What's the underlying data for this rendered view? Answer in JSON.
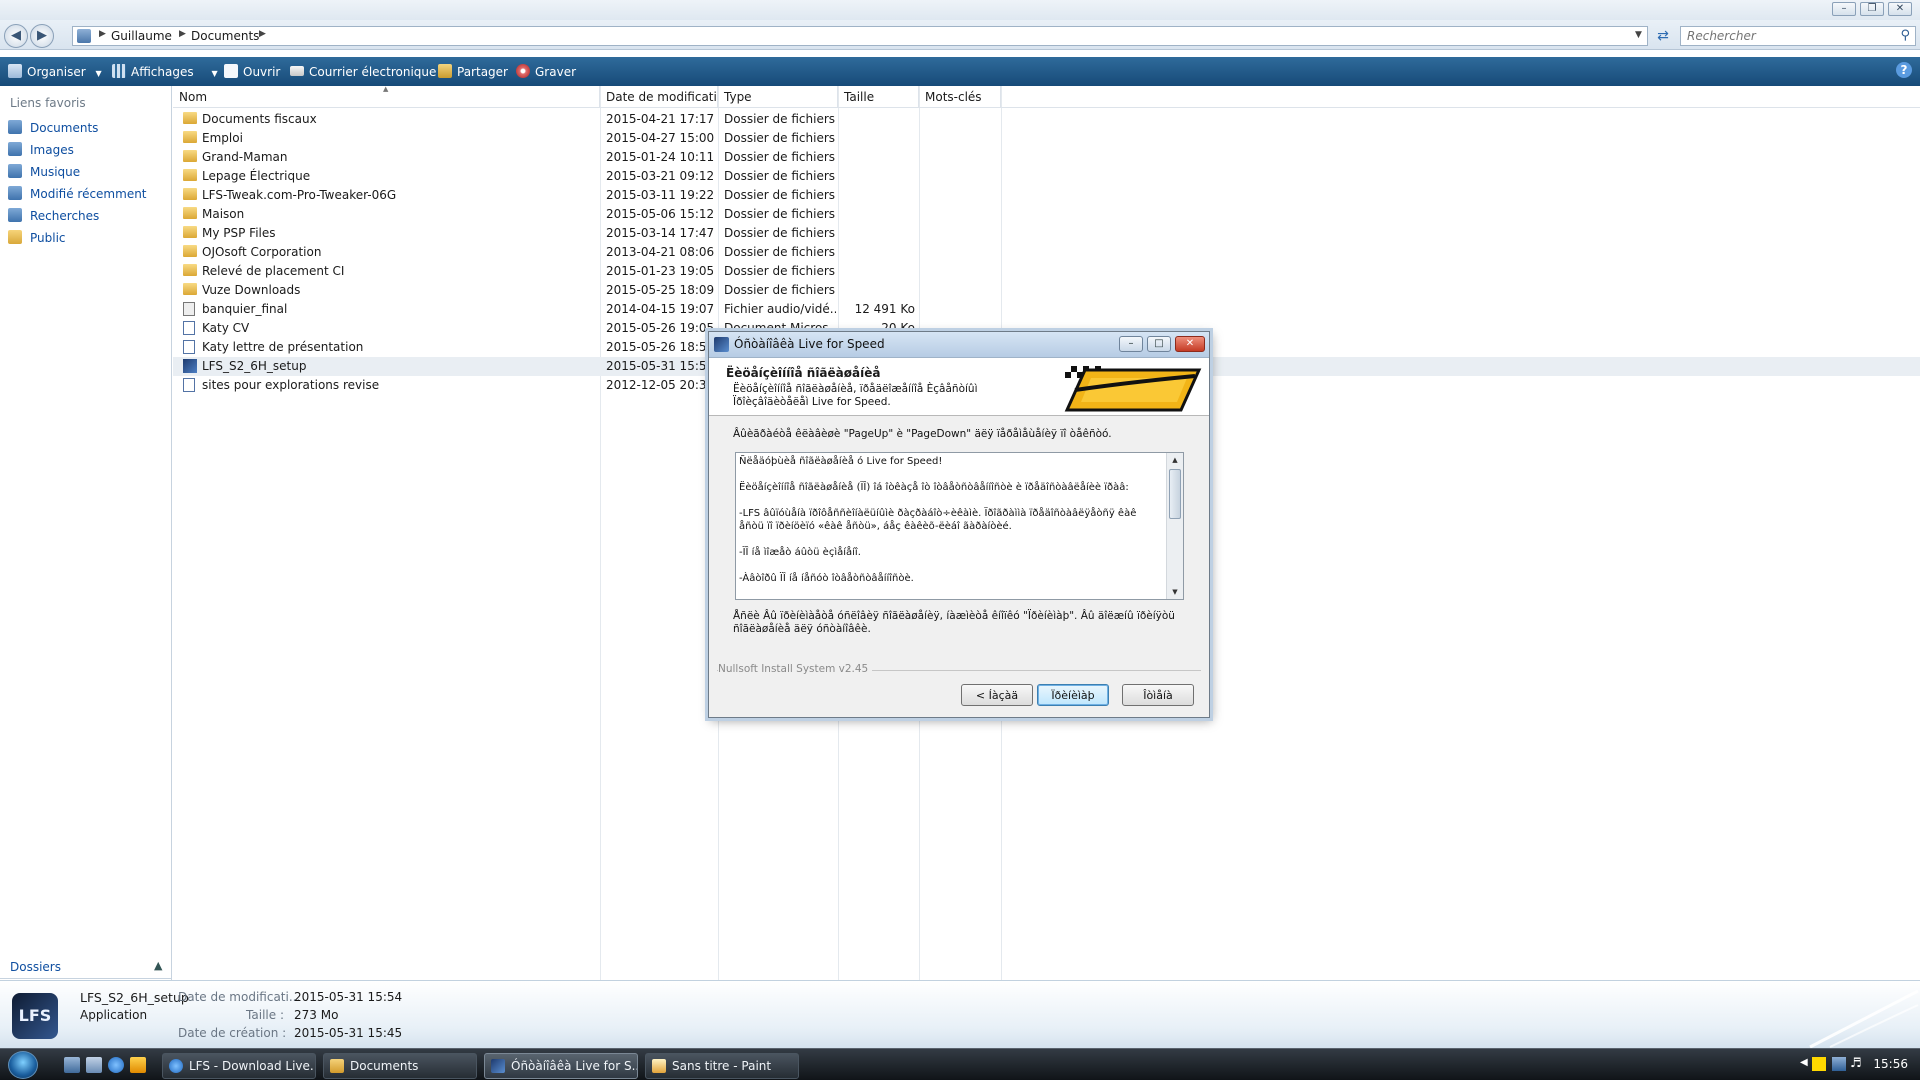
{
  "address": {
    "crumbs": [
      "Guillaume",
      "Documents"
    ],
    "search_placeholder": "Rechercher"
  },
  "toolbar": {
    "organize": "Organiser",
    "views": "Affichages",
    "open": "Ouvrir",
    "email": "Courrier électronique",
    "share": "Partager",
    "burn": "Graver"
  },
  "nav": {
    "heading": "Liens favoris",
    "items": [
      "Documents",
      "Images",
      "Musique",
      "Modifié récemment",
      "Recherches",
      "Public"
    ],
    "folders_label": "Dossiers"
  },
  "columns": {
    "name": "Nom",
    "date": "Date de modificati...",
    "type": "Type",
    "size": "Taille",
    "tags": "Mots-clés"
  },
  "files": [
    {
      "name": "Documents fiscaux",
      "date": "2015-04-21 17:17",
      "type": "Dossier de fichiers",
      "size": "",
      "icon": "folder-icon"
    },
    {
      "name": "Emploi",
      "date": "2015-04-27 15:00",
      "type": "Dossier de fichiers",
      "size": "",
      "icon": "folder-icon"
    },
    {
      "name": "Grand-Maman",
      "date": "2015-01-24 10:11",
      "type": "Dossier de fichiers",
      "size": "",
      "icon": "folder-icon"
    },
    {
      "name": "Lepage Électrique",
      "date": "2015-03-21 09:12",
      "type": "Dossier de fichiers",
      "size": "",
      "icon": "folder-icon"
    },
    {
      "name": "LFS-Tweak.com-Pro-Tweaker-06G",
      "date": "2015-03-11 19:22",
      "type": "Dossier de fichiers",
      "size": "",
      "icon": "folder-icon"
    },
    {
      "name": "Maison",
      "date": "2015-05-06 15:12",
      "type": "Dossier de fichiers",
      "size": "",
      "icon": "folder-icon"
    },
    {
      "name": "My PSP Files",
      "date": "2015-03-14 17:47",
      "type": "Dossier de fichiers",
      "size": "",
      "icon": "folder-icon"
    },
    {
      "name": "OJOsoft Corporation",
      "date": "2013-04-21 08:06",
      "type": "Dossier de fichiers",
      "size": "",
      "icon": "folder-icon"
    },
    {
      "name": "Relevé de placement CI",
      "date": "2015-01-23 19:05",
      "type": "Dossier de fichiers",
      "size": "",
      "icon": "folder-icon"
    },
    {
      "name": "Vuze Downloads",
      "date": "2015-05-25 18:09",
      "type": "Dossier de fichiers",
      "size": "",
      "icon": "folder-icon"
    },
    {
      "name": "banquier_final",
      "date": "2014-04-15 19:07",
      "type": "Fichier audio/vidé...",
      "size": "12 491 Ko",
      "icon": "media-file-icon"
    },
    {
      "name": "Katy CV",
      "date": "2015-05-26 19:05",
      "type": "Document Micros...",
      "size": "20 Ko",
      "icon": "word-document-icon"
    },
    {
      "name": "Katy lettre de présentation",
      "date": "2015-05-26 18:53",
      "type": "",
      "size": "",
      "icon": "word-document-icon"
    },
    {
      "name": "LFS_S2_6H_setup",
      "date": "2015-05-31 15:54",
      "type": "",
      "size": "",
      "icon": "application-icon",
      "selected": true
    },
    {
      "name": "sites pour explorations revise",
      "date": "2012-12-05 20:38",
      "type": "",
      "size": "",
      "icon": "word-document-icon"
    }
  ],
  "details": {
    "name": "LFS_S2_6H_setup",
    "kind": "Application",
    "date_modified_label": "Date de modificati...",
    "date_modified": "2015-05-31 15:54",
    "size_label": "Taille :",
    "size": "273 Mo",
    "date_created_label": "Date de création :",
    "date_created": "2015-05-31 15:45"
  },
  "dialog": {
    "title": "Óñòàíîâêà Live for Speed",
    "heading": "Ëèöåíçèîííîå ñîãëàøåíèå",
    "subtitle": "Ëèöåíçèîííîå ñîãëàøåíèå, ïðåäëîæåííîå Èçâåñòíûì Ïðîèçâîäèòåëåì Live for Speed.",
    "instruction": "Âûèãðàéòå êëàâèøè \"PageUp\" è \"PageDown\" äëÿ ïåðåìåùåíèÿ ïî òåêñòó.",
    "license_text": "Ñëåäóþùèå ñîãëàøåíèå ó Live for Speed!\n\nËèöåíçèîííîå ñîãëàøåíèå (ÏÎ) îá îòêàçå îò îòâåòñòâåííîñòè è ïðåäîñòàâëåíèè ïðàâ:\n\n-LFS âûïóùåíà ïðîôåññèîíàëüíûìè ðàçðàáîò÷èêàìè. Ïðîãðàììà ïðåäîñòàâëÿåòñÿ êàê åñòü ïî ïðèíöèïó «êàê åñòü», áåç êàêèõ-ëèáî ãàðàíòèé.\n\n-ÏÎ íå ìîæåò áûòü èçìåíåíî.\n\n-Àâòîðû ÏÎ íå íåñóò îòâåòñòâåííîñòè.",
    "accept_text": "Åñëè Âû ïðèíèìàåòå óñëîâèÿ ñîãëàøåíèÿ, íàæìèòå êíîïêó \"Ïðèíèìàþ\". Âû äîëæíû ïðèíÿòü ñîãëàøåíèå äëÿ óñòàíîâêè.",
    "nsis": "Nullsoft Install System v2.45",
    "back_btn": "< Íàçàä",
    "accept_btn": "Ïðèíèìàþ",
    "cancel_btn": "Îòìåíà"
  },
  "taskbar": {
    "tasks": [
      "LFS - Download Live...",
      "Documents",
      "Óñòàíîâêà Live for S...",
      "Sans titre - Paint"
    ],
    "clock": "15:56"
  }
}
